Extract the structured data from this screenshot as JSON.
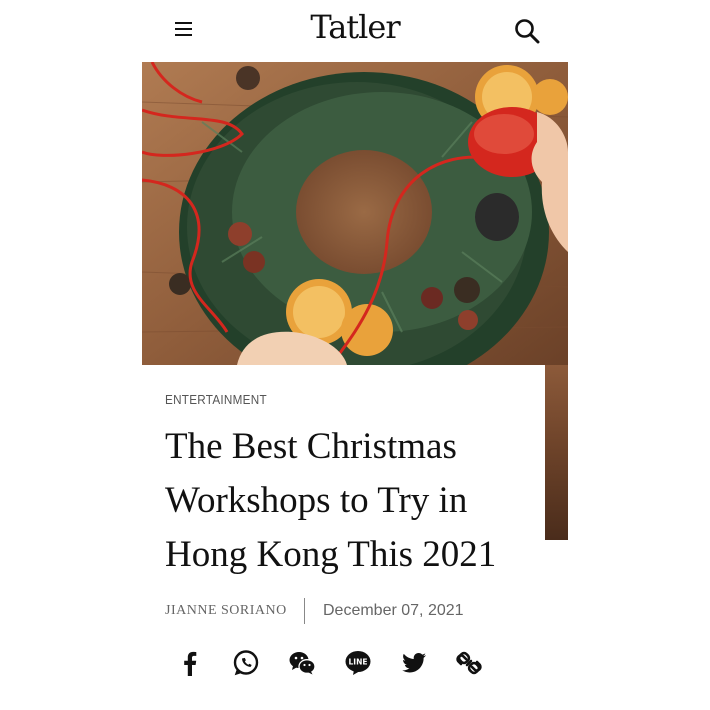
{
  "header": {
    "brand": "Tatler",
    "menu_icon": "hamburger-menu-icon",
    "search_icon": "search-icon"
  },
  "article": {
    "category": "ENTERTAINMENT",
    "title": "The Best Christmas Workshops to Try in Hong Kong This 2021",
    "author": "JIANNE SORIANO",
    "date": "December 07, 2021"
  },
  "share_icons": [
    "facebook-icon",
    "whatsapp-icon",
    "wechat-icon",
    "line-icon",
    "twitter-icon",
    "copy-link-icon"
  ],
  "colors": {
    "text": "#111111",
    "meta": "#666666",
    "ribbon": "#d4271e",
    "wood": "#9a6a45",
    "fir": "#2f4a33"
  }
}
